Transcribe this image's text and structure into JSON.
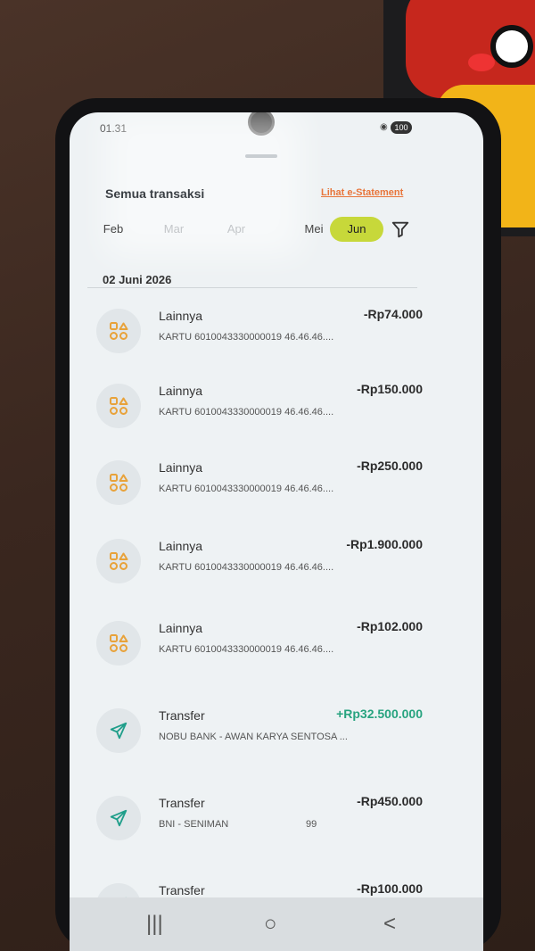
{
  "status": {
    "time": "01.31",
    "icons": "◉ ≈ ıll",
    "battery": "100"
  },
  "header": {
    "title": "Semua transaksi",
    "estatement_link": "Lihat e-Statement"
  },
  "months": [
    {
      "label": "Feb",
      "state": "normal"
    },
    {
      "label": "Mar",
      "state": "faded"
    },
    {
      "label": "Apr",
      "state": "faded"
    },
    {
      "label": "Mei",
      "state": "normal"
    },
    {
      "label": "Jun",
      "state": "active"
    }
  ],
  "section": {
    "date": "02 Juni 2026"
  },
  "transactions": [
    {
      "category": "Lainnya",
      "description": "KARTU 6010043330000019 46.46.46....",
      "amount": "-Rp74.000",
      "icon": "apps-icon",
      "positive": false
    },
    {
      "category": "Lainnya",
      "description": "KARTU 6010043330000019 46.46.46....",
      "amount": "-Rp150.000",
      "icon": "apps-icon",
      "positive": false
    },
    {
      "category": "Lainnya",
      "description": "KARTU 6010043330000019 46.46.46....",
      "amount": "-Rp250.000",
      "icon": "apps-icon",
      "positive": false
    },
    {
      "category": "Lainnya",
      "description": "KARTU 6010043330000019 46.46.46....",
      "amount": "-Rp1.900.000",
      "icon": "apps-icon",
      "positive": false
    },
    {
      "category": "Lainnya",
      "description": "KARTU 6010043330000019 46.46.46....",
      "amount": "-Rp102.000",
      "icon": "apps-icon",
      "positive": false
    },
    {
      "category": "Transfer",
      "description": "NOBU BANK - AWAN KARYA SENTOSA ...",
      "amount": "+Rp32.500.000",
      "icon": "send-icon",
      "positive": true
    },
    {
      "category": "Transfer",
      "description": "BNI - SENIMAN",
      "extra": "99",
      "amount": "-Rp450.000",
      "icon": "send-icon",
      "positive": false
    },
    {
      "category": "Transfer",
      "description": "",
      "amount": "-Rp100.000",
      "icon": "send-icon",
      "positive": false
    }
  ],
  "navbar": {
    "recents": "|||",
    "home": "○",
    "back": "<"
  },
  "colors": {
    "accent": "#c7d83a",
    "link": "#e8753a",
    "positive": "#27a37f",
    "icon_orange": "#e8a23a",
    "icon_teal": "#1f9e8a"
  }
}
